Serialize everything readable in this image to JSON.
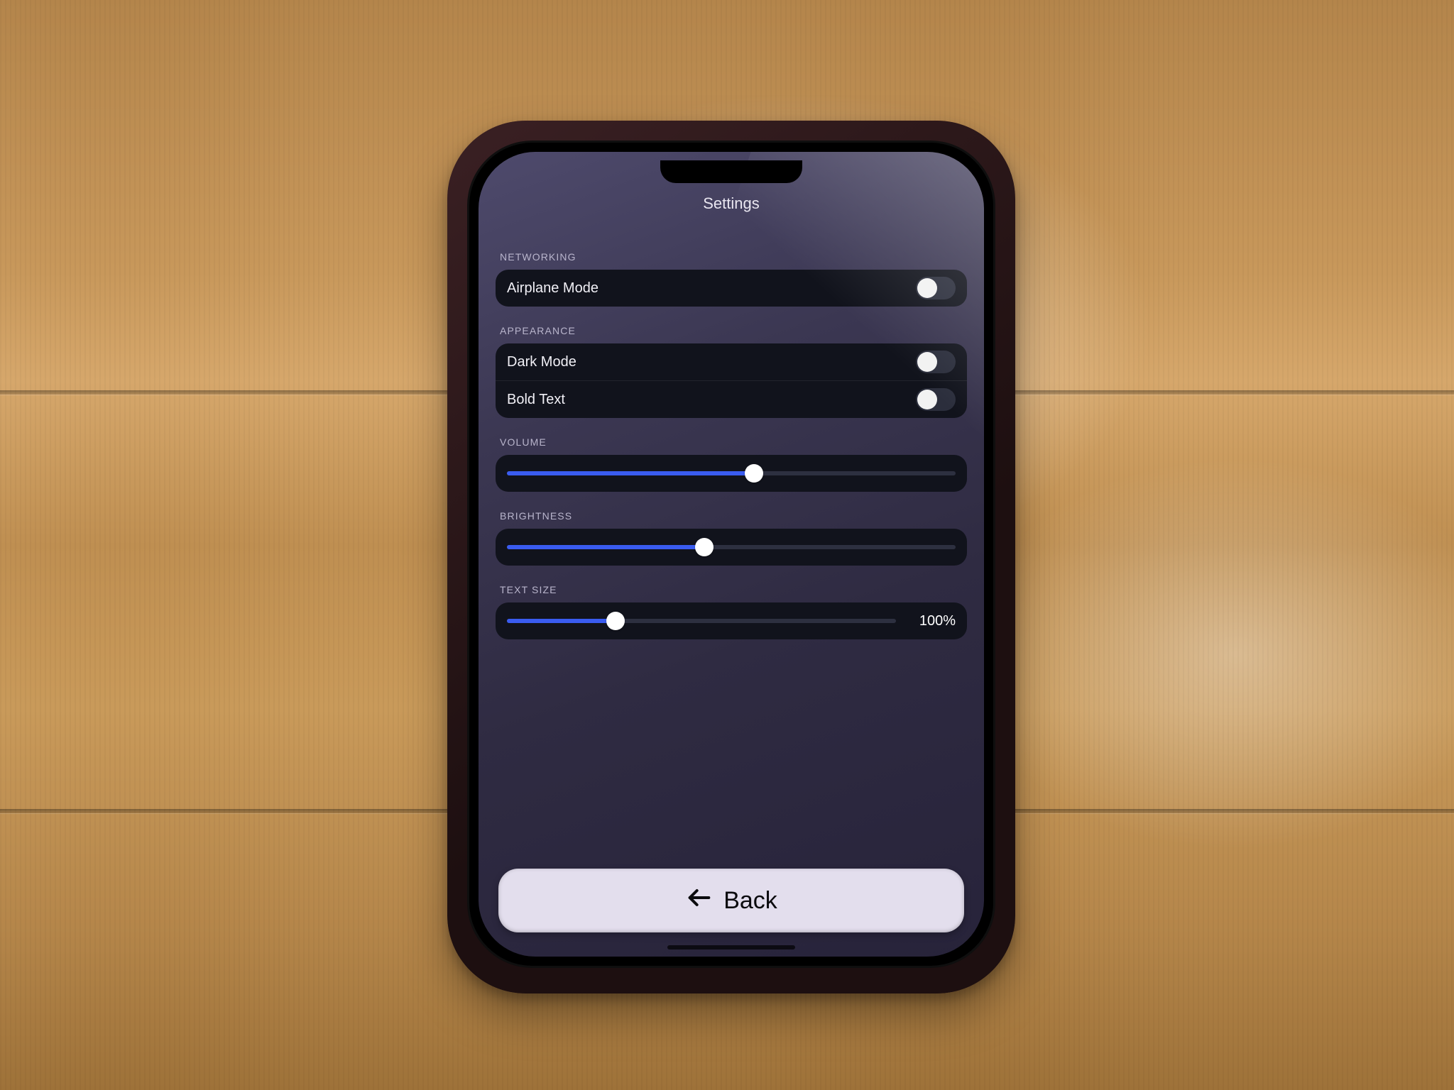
{
  "header": {
    "title": "Settings"
  },
  "sections": {
    "networking": {
      "label": "NETWORKING",
      "airplane": {
        "label": "Airplane Mode",
        "on": false
      }
    },
    "appearance": {
      "label": "APPEARANCE",
      "dark": {
        "label": "Dark Mode",
        "on": false
      },
      "bold": {
        "label": "Bold Text",
        "on": false
      }
    },
    "volume": {
      "label": "VOLUME",
      "percent": 55
    },
    "brightness": {
      "label": "BRIGHTNESS",
      "percent": 44
    },
    "textsize": {
      "label": "TEXT SIZE",
      "percent": 28,
      "display": "100%"
    }
  },
  "footer": {
    "back_label": "Back"
  },
  "colors": {
    "accent": "#3a5cf0",
    "panel": "#11131c",
    "screen": "#3b3752",
    "button": "#e3deed"
  }
}
